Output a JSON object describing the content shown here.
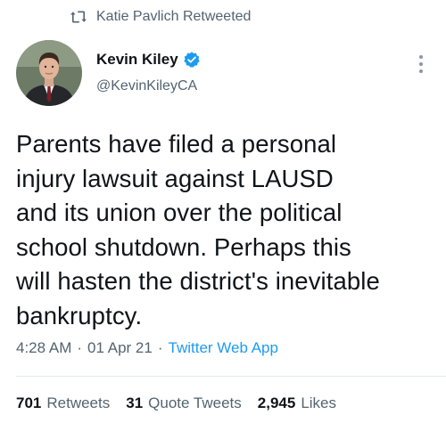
{
  "social_context": {
    "text": "Katie Pavlich Retweeted",
    "icon": "retweet-icon"
  },
  "author": {
    "display_name": "Kevin Kiley",
    "handle": "@KevinKileyCA",
    "verified": true,
    "verified_color": "#1d9bf0"
  },
  "tweet": {
    "text": "Parents have filed a personal\ninjury lawsuit against LAUSD\nand its union over the political\nschool shutdown. Perhaps this\nwill hasten the district's inevitable\nbankruptcy."
  },
  "meta": {
    "time": "4:28 AM",
    "separator": "·",
    "date": "01 Apr 21",
    "source": "Twitter Web App"
  },
  "stats": {
    "retweets_count": "701",
    "retweets_label": "Retweets",
    "quotes_count": "31",
    "quotes_label": "Quote Tweets",
    "likes_count": "2,945",
    "likes_label": "Likes"
  },
  "colors": {
    "text": "#0f1419",
    "secondary": "#536471",
    "link": "#1d9bf0"
  }
}
